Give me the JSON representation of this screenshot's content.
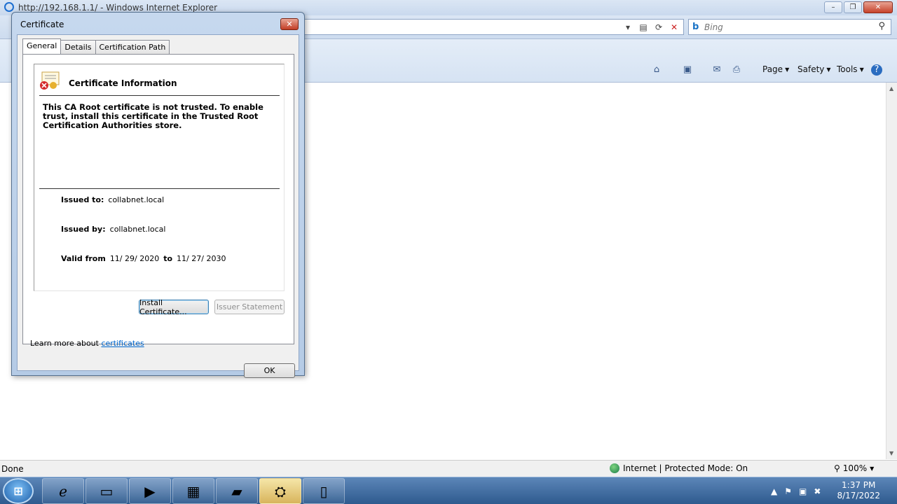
{
  "ie": {
    "title": "http://192.168.1.1/ - Windows Internet Explorer",
    "search_placeholder": "Bing",
    "commands": {
      "page": "Page",
      "safety": "Safety",
      "tools": "Tools"
    },
    "status": "Done",
    "zone": "Internet | Protected Mode: On",
    "zoom": "100%"
  },
  "dialog": {
    "title": "Certificate",
    "tabs": [
      "General",
      "Details",
      "Certification Path"
    ],
    "info_title": "Certificate Information",
    "warning": "This CA Root certificate is not trusted. To enable trust, install this certificate in the Trusted Root Certification Authorities store.",
    "issued_to_label": "Issued to:",
    "issued_to": "collabnet.local",
    "issued_by_label": "Issued by:",
    "issued_by": "collabnet.local",
    "valid_from_label": "Valid from",
    "valid_from": "11/ 29/ 2020",
    "to_label": "to",
    "valid_to": "11/ 27/ 2030",
    "install_button": "Install Certificate...",
    "issuer_button": "Issuer Statement",
    "learn_text": "Learn more about",
    "learn_link": "certificates",
    "ok_button": "OK"
  },
  "taskbar": {
    "time": "1:37 PM",
    "date": "8/17/2022"
  }
}
